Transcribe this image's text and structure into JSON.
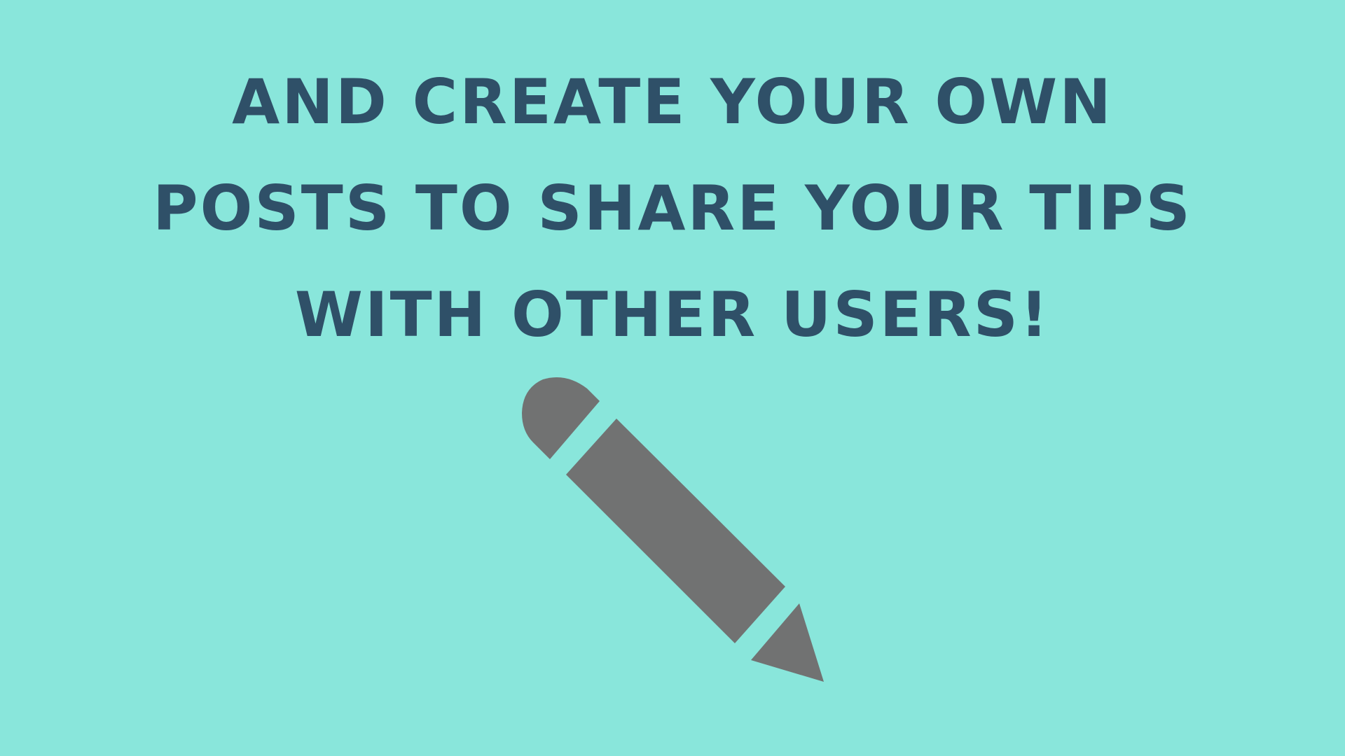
{
  "slide": {
    "headline_lines": [
      "AND CREATE YOUR OWN",
      "POSTS TO SHARE YOUR TIPS",
      "WITH OTHER USERS!"
    ]
  },
  "colors": {
    "background": "#89e6db",
    "text": "#2f5068",
    "icon": "#717272"
  },
  "icon": "pencil-icon"
}
